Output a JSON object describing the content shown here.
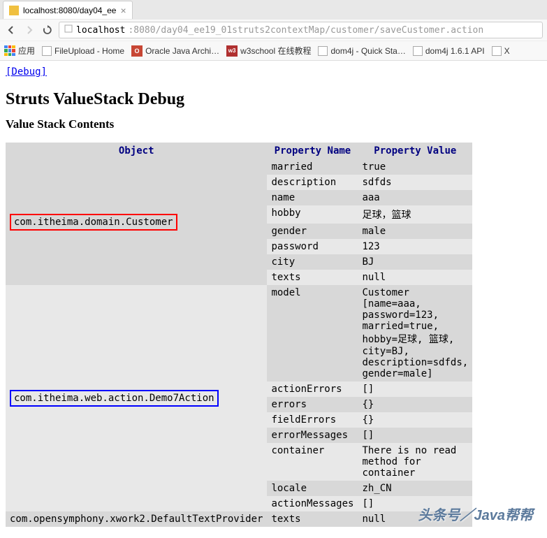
{
  "tab": {
    "title": "localhost:8080/day04_ee",
    "close": "×"
  },
  "url": {
    "host": "localhost",
    "path": ":8080/day04_ee19_01struts2contextMap/customer/saveCustomer.action"
  },
  "bookmarks": {
    "apps": "应用",
    "items": [
      "FileUpload - Home",
      "Oracle Java Archi…",
      "w3school 在线教程",
      "dom4j - Quick Sta…",
      "dom4j 1.6.1 API",
      "X"
    ]
  },
  "page": {
    "debug_link": "[Debug]",
    "title": "Struts ValueStack Debug",
    "subtitle": "Value Stack Contents"
  },
  "table": {
    "headers": {
      "object": "Object",
      "prop_name": "Property Name",
      "prop_value": "Property Value"
    },
    "groups": [
      {
        "object": "com.itheima.domain.Customer",
        "highlight": "red",
        "rows": [
          {
            "name": "married",
            "value": "true"
          },
          {
            "name": "description",
            "value": "sdfds"
          },
          {
            "name": "name",
            "value": "aaa"
          },
          {
            "name": "hobby",
            "value": "足球，篮球"
          },
          {
            "name": "gender",
            "value": "male"
          },
          {
            "name": "password",
            "value": "123"
          },
          {
            "name": "city",
            "value": "BJ"
          },
          {
            "name": "texts",
            "value": "null"
          }
        ]
      },
      {
        "object": "com.itheima.web.action.Demo7Action",
        "highlight": "blue",
        "rows": [
          {
            "name": "model",
            "value": "Customer [name=aaa, password=123, married=true, hobby=足球, 篮球, city=BJ, description=sdfds, gender=male]"
          },
          {
            "name": "actionErrors",
            "value": "[]"
          },
          {
            "name": "errors",
            "value": "{}"
          },
          {
            "name": "fieldErrors",
            "value": "{}"
          },
          {
            "name": "errorMessages",
            "value": "[]"
          },
          {
            "name": "container",
            "value": "There is no read method for container"
          },
          {
            "name": "locale",
            "value": "zh_CN"
          },
          {
            "name": "actionMessages",
            "value": "[]"
          }
        ]
      },
      {
        "object": "com.opensymphony.xwork2.DefaultTextProvider",
        "highlight": "none",
        "rows": [
          {
            "name": "texts",
            "value": "null"
          }
        ]
      }
    ]
  },
  "watermark": "头条号／Java帮帮"
}
